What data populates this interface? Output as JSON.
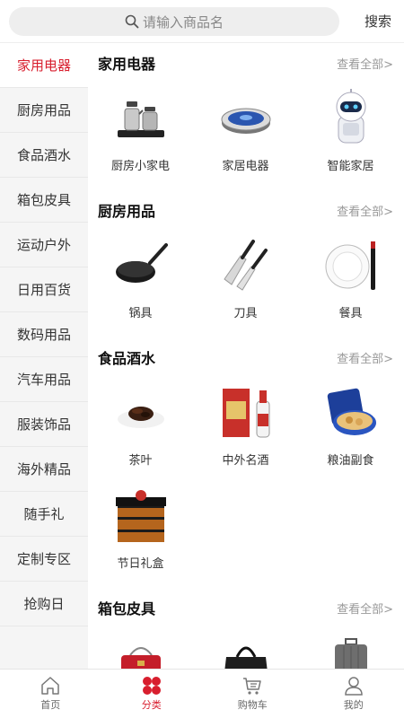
{
  "search": {
    "placeholder": "请输入商品名",
    "button_label": "搜索"
  },
  "sidebar": {
    "items": [
      {
        "label": "家用电器",
        "active": true
      },
      {
        "label": "厨房用品"
      },
      {
        "label": "食品酒水"
      },
      {
        "label": "箱包皮具"
      },
      {
        "label": "运动户外"
      },
      {
        "label": "日用百货"
      },
      {
        "label": "数码用品"
      },
      {
        "label": "汽车用品"
      },
      {
        "label": "服装饰品"
      },
      {
        "label": "海外精品"
      },
      {
        "label": "随手礼"
      },
      {
        "label": "定制专区"
      },
      {
        "label": "抢购日"
      }
    ]
  },
  "main": {
    "sections": [
      {
        "title": "家用电器",
        "more": "查看全部>",
        "items": [
          {
            "label": "厨房小家电",
            "icon": "kettle-set-icon"
          },
          {
            "label": "家居电器",
            "icon": "robot-vacuum-icon"
          },
          {
            "label": "智能家居",
            "icon": "smart-robot-icon"
          }
        ]
      },
      {
        "title": "厨房用品",
        "more": "查看全部>",
        "items": [
          {
            "label": "锅具",
            "icon": "wok-icon"
          },
          {
            "label": "刀具",
            "icon": "knives-icon"
          },
          {
            "label": "餐具",
            "icon": "plate-icon"
          }
        ]
      },
      {
        "title": "食品酒水",
        "more": "查看全部>",
        "items": [
          {
            "label": "茶叶",
            "icon": "tea-leaves-icon"
          },
          {
            "label": "中外名酒",
            "icon": "liquor-bottle-icon"
          },
          {
            "label": "粮油副食",
            "icon": "cookie-tin-icon"
          },
          {
            "label": "节日礼盒",
            "icon": "gift-box-icon"
          }
        ]
      },
      {
        "title": "箱包皮具",
        "more": "查看全部>",
        "items": [
          {
            "label": "",
            "icon": "red-handbag-icon"
          },
          {
            "label": "",
            "icon": "black-handbag-icon"
          },
          {
            "label": "",
            "icon": "suitcase-icon"
          }
        ]
      }
    ]
  },
  "tabbar": {
    "tabs": [
      {
        "label": "首页",
        "icon": "home-icon"
      },
      {
        "label": "分类",
        "icon": "category-icon",
        "active": true
      },
      {
        "label": "购物车",
        "icon": "cart-icon"
      },
      {
        "label": "我的",
        "icon": "profile-icon"
      }
    ]
  },
  "colors": {
    "accent": "#d81e2e",
    "sidebar_bg": "#f5f5f5"
  }
}
